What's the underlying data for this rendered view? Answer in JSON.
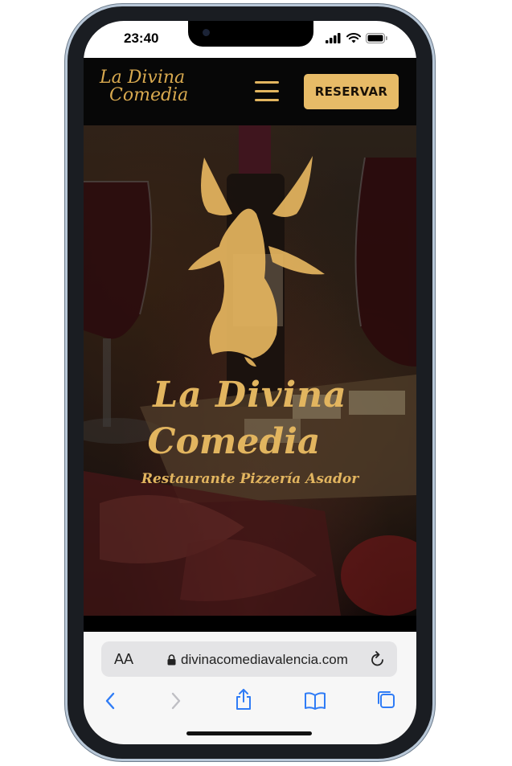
{
  "status_bar": {
    "time": "23:40"
  },
  "header": {
    "logo_line1": "La Divina",
    "logo_line2": "Comedia",
    "reserve_label": "RESERVAR"
  },
  "hero": {
    "title_line1": "La Divina",
    "title_line2": "Comedia",
    "subtitle": "Restaurante Pizzería Asador"
  },
  "browser": {
    "text_size_label": "AA",
    "url": "divinacomediavalencia.com"
  },
  "icons": {
    "menu": "hamburger-menu-icon",
    "back": "chevron-left-icon",
    "forward": "chevron-right-icon",
    "share": "share-icon",
    "bookmarks": "book-icon",
    "tabs": "tabs-icon",
    "lock": "lock-icon",
    "reload": "reload-icon"
  },
  "colors": {
    "gold": "#e2b55f",
    "button": "#e7bb67",
    "header_bg": "#070707",
    "link_blue": "#2f7cf6"
  }
}
